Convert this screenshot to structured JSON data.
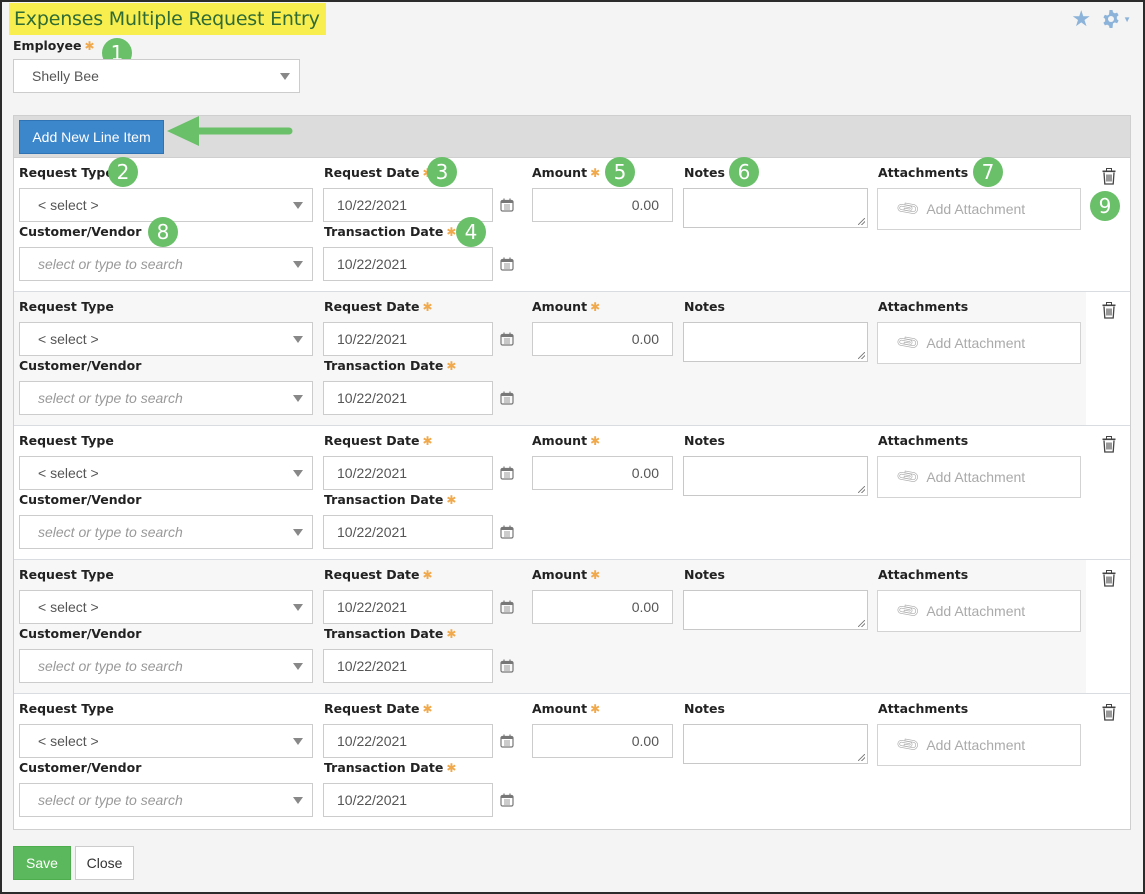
{
  "page": {
    "title": "Expenses Multiple Request Entry"
  },
  "header_icons": {
    "favorite": "star-icon",
    "settings": "gear-icon"
  },
  "employee": {
    "label": "Employee",
    "required_mark": "✱",
    "value": "Shelly Bee"
  },
  "toolbar": {
    "add_line_label": "Add New Line Item"
  },
  "labels": {
    "request_type": "Request Type",
    "customer_vendor": "Customer/Vendor",
    "request_date": "Request Date",
    "transaction_date": "Transaction Date",
    "amount": "Amount",
    "notes": "Notes",
    "attachments": "Attachments",
    "required_mark": "✱"
  },
  "line_items": [
    {
      "request_type": "< select >",
      "customer_placeholder": "select or type to search",
      "request_date": "10/22/2021",
      "transaction_date": "10/22/2021",
      "amount": "0.00",
      "notes": "",
      "attachment_label": "Add Attachment"
    },
    {
      "request_type": "< select >",
      "customer_placeholder": "select or type to search",
      "request_date": "10/22/2021",
      "transaction_date": "10/22/2021",
      "amount": "0.00",
      "notes": "",
      "attachment_label": "Add Attachment"
    },
    {
      "request_type": "< select >",
      "customer_placeholder": "select or type to search",
      "request_date": "10/22/2021",
      "transaction_date": "10/22/2021",
      "amount": "0.00",
      "notes": "",
      "attachment_label": "Add Attachment"
    },
    {
      "request_type": "< select >",
      "customer_placeholder": "select or type to search",
      "request_date": "10/22/2021",
      "transaction_date": "10/22/2021",
      "amount": "0.00",
      "notes": "",
      "attachment_label": "Add Attachment"
    },
    {
      "request_type": "< select >",
      "customer_placeholder": "select or type to search",
      "request_date": "10/22/2021",
      "transaction_date": "10/22/2021",
      "amount": "0.00",
      "notes": "",
      "attachment_label": "Add Attachment"
    }
  ],
  "annotations": {
    "badges": [
      "1",
      "2",
      "3",
      "4",
      "5",
      "6",
      "7",
      "8",
      "9"
    ],
    "color": "#6abf69"
  },
  "footer": {
    "save_label": "Save",
    "close_label": "Close"
  },
  "colors": {
    "title_highlight": "#f8ee4d",
    "title_text": "#2e6b35",
    "primary_button": "#3c86cc",
    "save_button": "#5cb85c",
    "required": "#f0a94c",
    "header_icon": "#8cb3d9"
  }
}
